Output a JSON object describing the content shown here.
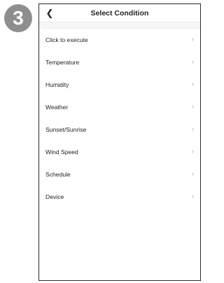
{
  "step": {
    "number": "3",
    "color": "#8e8e8e"
  },
  "header": {
    "title": "Select Condition",
    "back_icon": "chevron-left-icon"
  },
  "conditions": [
    {
      "label": "Click to execute"
    },
    {
      "label": "Temperature"
    },
    {
      "label": "Humidity"
    },
    {
      "label": "Weather"
    },
    {
      "label": "Sunset/Sunrise"
    },
    {
      "label": "Wind Speed"
    },
    {
      "label": "Schedule"
    },
    {
      "label": "Device"
    }
  ]
}
